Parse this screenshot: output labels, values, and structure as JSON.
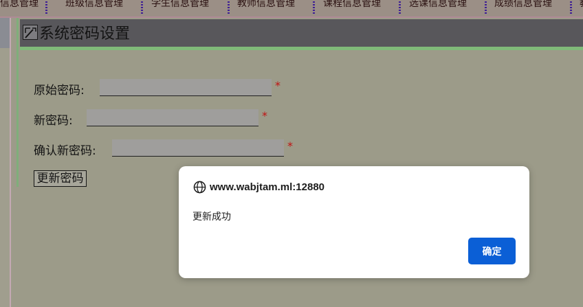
{
  "nav": {
    "items": [
      {
        "label": "信息管理"
      },
      {
        "label": "班级信息管理"
      },
      {
        "label": "学生信息管理"
      },
      {
        "label": "教师信息管理"
      },
      {
        "label": "课程信息管理"
      },
      {
        "label": "选课信息管理"
      },
      {
        "label": "成绩信息管理"
      },
      {
        "label": "教"
      }
    ]
  },
  "panel": {
    "title": "系统密码设置",
    "icon": "edit-icon"
  },
  "form": {
    "old_password": {
      "label": "原始密码:",
      "value": "",
      "required": "*"
    },
    "new_password": {
      "label": "新密码:",
      "value": "",
      "required": "*"
    },
    "confirm_password": {
      "label": "确认新密码:",
      "value": "",
      "required": "*"
    },
    "submit_label": "更新密码"
  },
  "dialog": {
    "origin": "www.wabjtam.ml:12880",
    "message": "更新成功",
    "ok_label": "确定",
    "ok_color": "#0b5fd6",
    "icon": "globe-icon"
  },
  "colors": {
    "background": "#9c9b89",
    "header_bg": "#58575b",
    "accent_green": "#80ba79",
    "required_red": "#c01212"
  }
}
